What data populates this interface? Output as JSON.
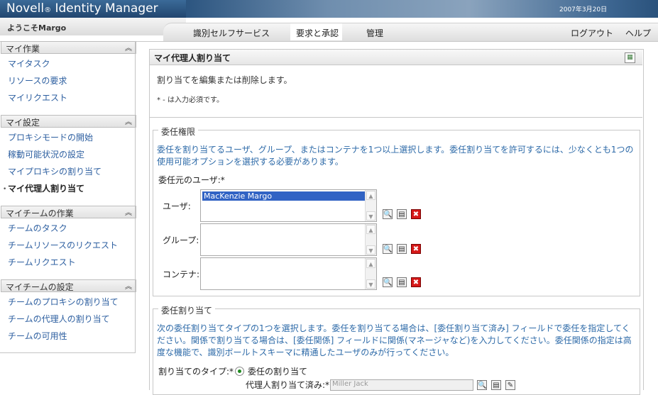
{
  "app": {
    "title_main": "Novell",
    "title_reg": "®",
    "title_rest": " Identity Manager",
    "date": "2007年3月20日"
  },
  "header": {
    "welcome": "ようこそMargo"
  },
  "tabs": [
    {
      "label": "識別セルフサービス"
    },
    {
      "label": "要求と承認"
    },
    {
      "label": "管理"
    }
  ],
  "header_links": {
    "logout": "ログアウト",
    "help": "ヘルプ"
  },
  "sidebar": {
    "sections": [
      {
        "title": "マイ作業",
        "items": [
          "マイタスク",
          "リソースの要求",
          "マイリクエスト"
        ]
      },
      {
        "title": "マイ設定",
        "items": [
          "プロキシモードの開始",
          "稼動可能状況の設定",
          "マイプロキシの割り当て",
          "マイ代理人割り当て"
        ]
      },
      {
        "title": "マイチームの作業",
        "items": [
          "チームのタスク",
          "チームリソースのリクエスト",
          "チームリクエスト"
        ]
      },
      {
        "title": "マイチームの設定",
        "items": [
          "チームのプロキシの割り当て",
          "チームの代理人の割り当て",
          "チームの可用性"
        ]
      }
    ]
  },
  "panel": {
    "title": "マイ代理人割り当て",
    "description": "割り当てを編集または削除します。",
    "required_note": "* - は入力必須です。"
  },
  "delegation": {
    "legend": "委任権限",
    "info": "委任を割り当てるユーザ、グループ、またはコンテナを1つ以上選択します。委任割り当てを許可するには、少なくとも1つの使用可能オプションを選択する必要があります。",
    "from_user_label": "委任元のユーザ:*",
    "user_label": "ユーザ:",
    "user_selected": "MacKenzie Margo",
    "group_label": "グループ:",
    "container_label": "コンテナ:"
  },
  "assignment": {
    "legend": "委任割り当て",
    "info": "次の委任割り当てタイプの1つを選択します。委任を割り当てる場合は、[委任割り当て済み] フィールドで委任を指定してください。関係で割り当てる場合は、[委任関係] フィールドに関係(マネージャなど)を入力してください。委任関係の指定は高度な機能で、識別ボールトスキーマに精通したユーザのみが行ってください。",
    "type_label": "割り当てのタイプ:*",
    "type_option": "委任の割り当て",
    "proxy_label": "代理人割り当て済み:*",
    "proxy_value": "Miller Jack"
  },
  "colors": {
    "banner": "#2c5580",
    "link": "#2d5fa0",
    "info_text": "#2d6aa8",
    "selection": "#3163c4"
  }
}
